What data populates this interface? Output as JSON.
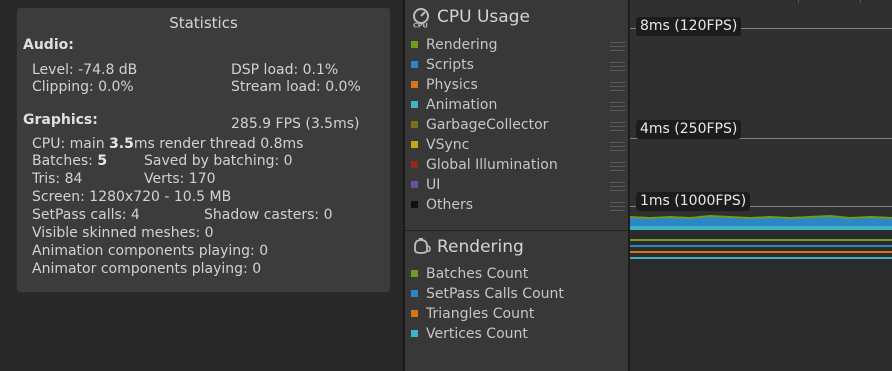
{
  "stats": {
    "title": "Statistics",
    "audio_header": "Audio:",
    "level": "Level: -74.8 dB",
    "clipping": "Clipping: 0.0%",
    "dsp": "DSP load: 0.1%",
    "stream": "Stream load: 0.0%",
    "graphics_header": "Graphics:",
    "fps": "285.9 FPS (3.5ms)",
    "cpu_prefix": "CPU: main ",
    "cpu_main": "3.5",
    "cpu_suffix": "ms  render thread 0.8ms",
    "batches_prefix": "Batches: ",
    "batches_value": "5",
    "saved": "Saved by batching: 0",
    "tris": "Tris: 84",
    "verts": "Verts: 170",
    "screen": "Screen: 1280x720 - 10.5 MB",
    "setpass": "SetPass calls: 4",
    "shadow": "Shadow casters: 0",
    "skinned": "Visible skinned meshes: 0",
    "anim_components": "Animation components playing: 0",
    "animator_components": "Animator components playing: 0"
  },
  "cpu_module": {
    "title": "CPU Usage",
    "icon": "cpu-icon",
    "items": [
      {
        "label": "Rendering",
        "color": "#6f9b1e"
      },
      {
        "label": "Scripts",
        "color": "#2b87c6"
      },
      {
        "label": "Physics",
        "color": "#d8721b"
      },
      {
        "label": "Animation",
        "color": "#3fb2c4"
      },
      {
        "label": "GarbageCollector",
        "color": "#747417"
      },
      {
        "label": "VSync",
        "color": "#c4a519"
      },
      {
        "label": "Global Illumination",
        "color": "#8d2a1c"
      },
      {
        "label": "UI",
        "color": "#6a4ea0"
      },
      {
        "label": "Others",
        "color": "#101010"
      }
    ]
  },
  "rendering_module": {
    "title": "Rendering",
    "icon": "teapot-icon",
    "items": [
      {
        "label": "Batches Count",
        "color": "#6f9b1e"
      },
      {
        "label": "SetPass Calls Count",
        "color": "#2b87c6"
      },
      {
        "label": "Triangles Count",
        "color": "#d8721b"
      },
      {
        "label": "Vertices Count",
        "color": "#3fb2c4"
      }
    ]
  },
  "chart": {
    "markers": [
      "8ms (120FPS)",
      "4ms (250FPS)",
      "1ms (1000FPS)"
    ]
  }
}
